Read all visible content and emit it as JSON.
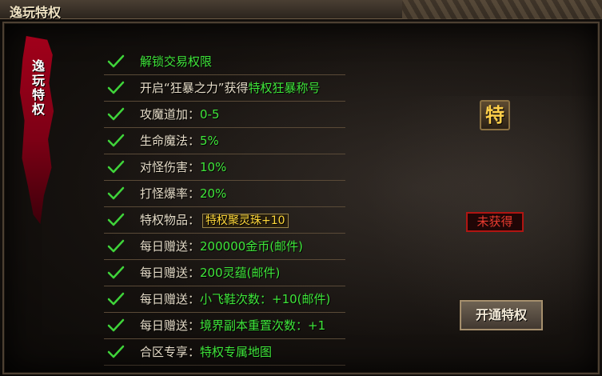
{
  "window": {
    "title": "逸玩特权"
  },
  "banner": {
    "text": "逸玩特权"
  },
  "perks": [
    {
      "label": "",
      "value": "解锁交易权限"
    },
    {
      "label": "开启“狂暴之力”获得",
      "value": "特权狂暴称号"
    },
    {
      "label": "攻魔道加：",
      "value": "0-5"
    },
    {
      "label": "生命魔法：",
      "value": "5%"
    },
    {
      "label": "对怪伤害：",
      "value": "10%"
    },
    {
      "label": "打怪爆率：",
      "value": "20%"
    },
    {
      "label": "特权物品：",
      "value": "特权聚灵珠+10",
      "boxed": true
    },
    {
      "label": "每日赠送：",
      "value": "200000金币(邮件)"
    },
    {
      "label": "每日赠送：",
      "value": "200灵蕴(邮件)"
    },
    {
      "label": "每日赠送：",
      "value": "小飞鞋次数：+10(邮件)"
    },
    {
      "label": "每日赠送：",
      "value": "境界副本重置次数：+1"
    },
    {
      "label": "合区专享：",
      "value": "特权专属地图"
    }
  ],
  "side": {
    "badge_char": "特",
    "status": "未获得",
    "open_button": "开通特权"
  },
  "colors": {
    "value_green": "#3fe53a",
    "check_green": "#3fd43a",
    "status_red": "#e83b2f",
    "banner_red": "#a1001a"
  },
  "icons": {
    "check": "check-icon"
  }
}
